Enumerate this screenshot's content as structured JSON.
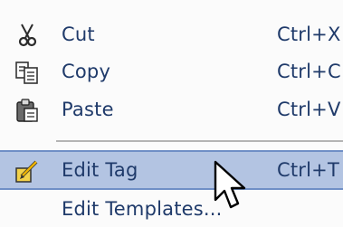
{
  "menu": {
    "items": [
      {
        "label": "Cut",
        "shortcut": "Ctrl+X",
        "icon": "scissors-icon"
      },
      {
        "label": "Copy",
        "shortcut": "Ctrl+C",
        "icon": "copy-icon"
      },
      {
        "label": "Paste",
        "shortcut": "Ctrl+V",
        "icon": "paste-icon"
      },
      {
        "label": "Edit Tag",
        "shortcut": "Ctrl+T",
        "icon": "edit-tag-icon",
        "highlighted": true
      },
      {
        "label": "Edit Templates...",
        "shortcut": "",
        "icon": ""
      }
    ]
  },
  "colors": {
    "text": "#1f3a6a",
    "highlight_bg": "#b3c4e2",
    "highlight_border": "#6f8fc6",
    "menu_bg": "#fbfbfb"
  },
  "cursor": "arrow-pointer-icon"
}
